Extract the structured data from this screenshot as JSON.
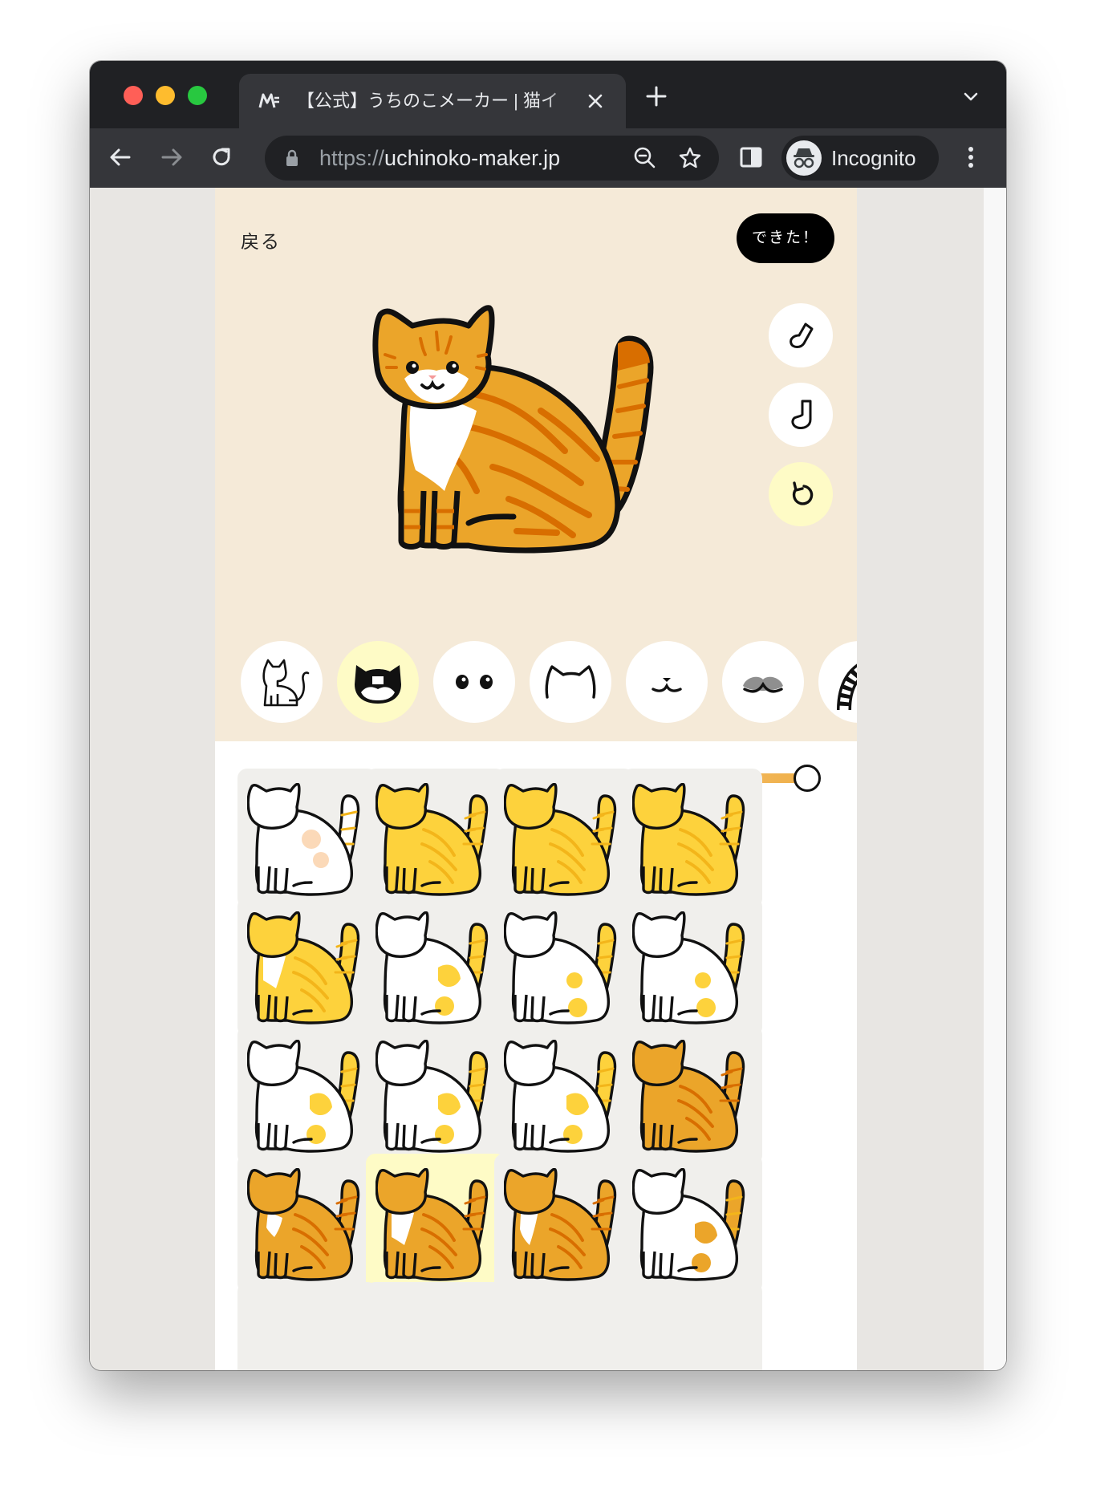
{
  "browser": {
    "tab_title": "【公式】うちのこメーカー | 猫イ",
    "url_scheme": "https://",
    "url_host": "uchinoko-maker.jp",
    "profile_label": "Incognito"
  },
  "page": {
    "back_label": "戻る",
    "done_label": "できた！",
    "side_tools": [
      "short-sock-icon",
      "long-sock-icon",
      "reset-icon"
    ],
    "parts": [
      {
        "name": "body-part-icon",
        "selected": false
      },
      {
        "name": "face-pattern-part-icon",
        "selected": true
      },
      {
        "name": "eyes-part-icon",
        "selected": false
      },
      {
        "name": "ears-part-icon",
        "selected": false
      },
      {
        "name": "mouth-part-icon",
        "selected": false
      },
      {
        "name": "nose-part-icon",
        "selected": false
      },
      {
        "name": "tail-part-icon",
        "selected": false
      }
    ],
    "slider_value": 1.0,
    "colors": {
      "stage_bg": "#f5ead8",
      "selected_bg": "#fefbc6",
      "cell_bg": "#f0efec",
      "cat_orange": "#eba52a",
      "cat_stripe": "#d86e00",
      "cat_yellow": "#fdd23c",
      "cat_yellow_stripe": "#f3b51a"
    },
    "patterns": [
      {
        "base": "white",
        "patch": "peach",
        "selected": false
      },
      {
        "base": "yellow-tabby",
        "patch": "none",
        "selected": false
      },
      {
        "base": "yellow-tabby",
        "patch": "none",
        "selected": false
      },
      {
        "base": "yellow-tabby",
        "patch": "none",
        "selected": false
      },
      {
        "base": "yellow-tabby",
        "patch": "white-chest",
        "selected": false
      },
      {
        "base": "white",
        "patch": "yellow-patches",
        "selected": false
      },
      {
        "base": "white",
        "patch": "yellow-spots",
        "selected": false
      },
      {
        "base": "white",
        "patch": "yellow-spots",
        "selected": false
      },
      {
        "base": "white",
        "patch": "yellow-patches",
        "selected": false
      },
      {
        "base": "white",
        "patch": "yellow-patches",
        "selected": false
      },
      {
        "base": "white",
        "patch": "yellow-patches",
        "selected": false
      },
      {
        "base": "orange-tabby",
        "patch": "none",
        "selected": false
      },
      {
        "base": "orange-tabby",
        "patch": "small-white-chest",
        "selected": false
      },
      {
        "base": "orange-tabby",
        "patch": "white-chest",
        "selected": true
      },
      {
        "base": "orange-tabby",
        "patch": "white-face",
        "selected": false
      },
      {
        "base": "white",
        "patch": "orange-tabby-patches",
        "selected": false
      }
    ]
  }
}
